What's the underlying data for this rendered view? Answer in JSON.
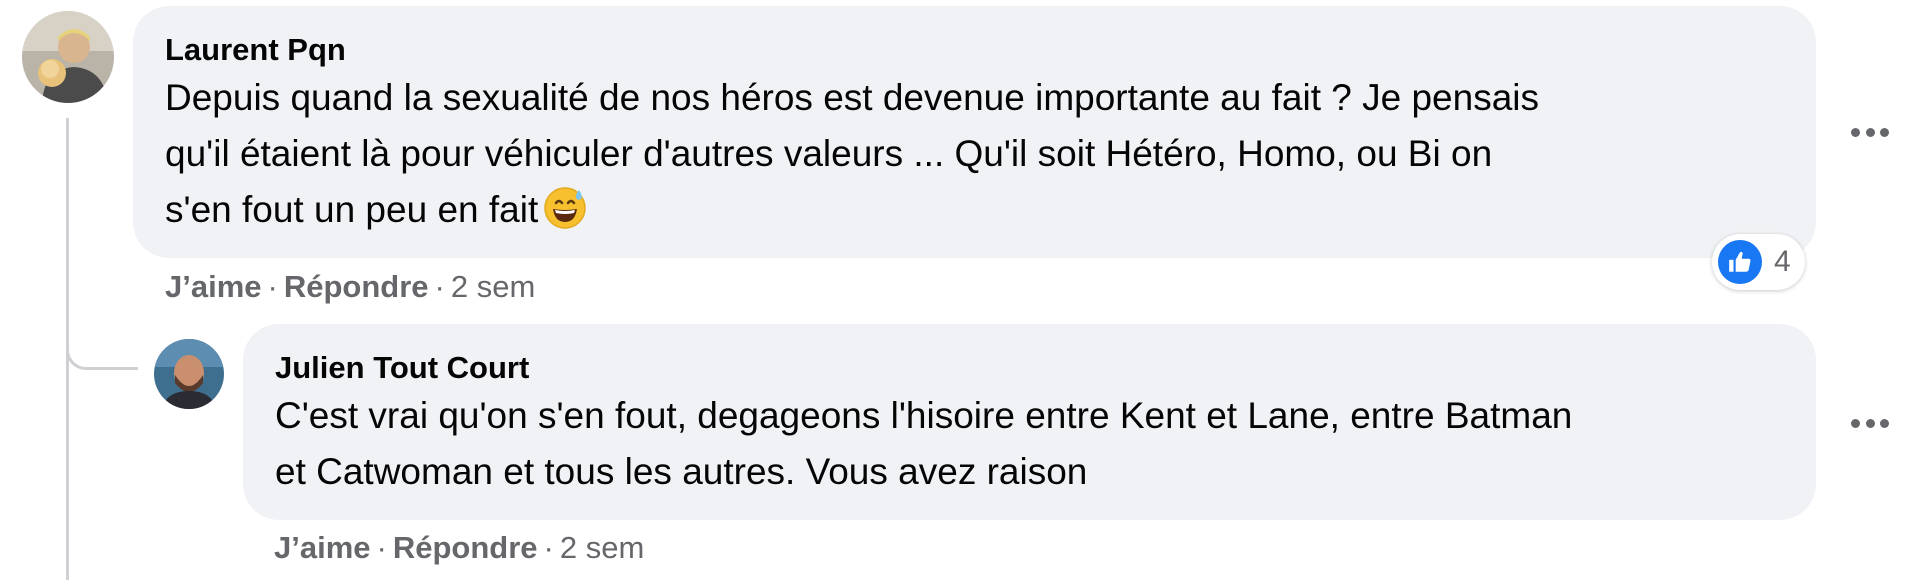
{
  "comments": [
    {
      "author": "Laurent Pqn",
      "text_lines": [
        "Depuis quand la sexualité de nos héros est devenue importante au fait ? Je pensais",
        "qu'il étaient là pour véhiculer d'autres valeurs ... Qu'il soit Hétéro, Homo, ou Bi on",
        "s'en fout un peu en fait"
      ],
      "emoji": "grinning-sweat-emoji",
      "like_label": "J’aime",
      "reply_label": "Répondre",
      "separator": "·",
      "timestamp": "2 sem",
      "reaction": {
        "icon": "thumbs-up-icon",
        "count": "4"
      }
    },
    {
      "author": "Julien Tout Court",
      "text_lines": [
        "C'est vrai qu'on s'en fout, degageons l'hisoire entre Kent et Lane, entre Batman",
        "et Catwoman et tous les autres. Vous avez raison"
      ],
      "like_label": "J’aime",
      "reply_label": "Répondre",
      "separator": "·",
      "timestamp": "2 sem"
    }
  ],
  "colors": {
    "bubble_bg": "#f0f2f5",
    "secondary_text": "#65676b",
    "like_blue": "#1877f2",
    "thread_line": "#ced0d4"
  }
}
